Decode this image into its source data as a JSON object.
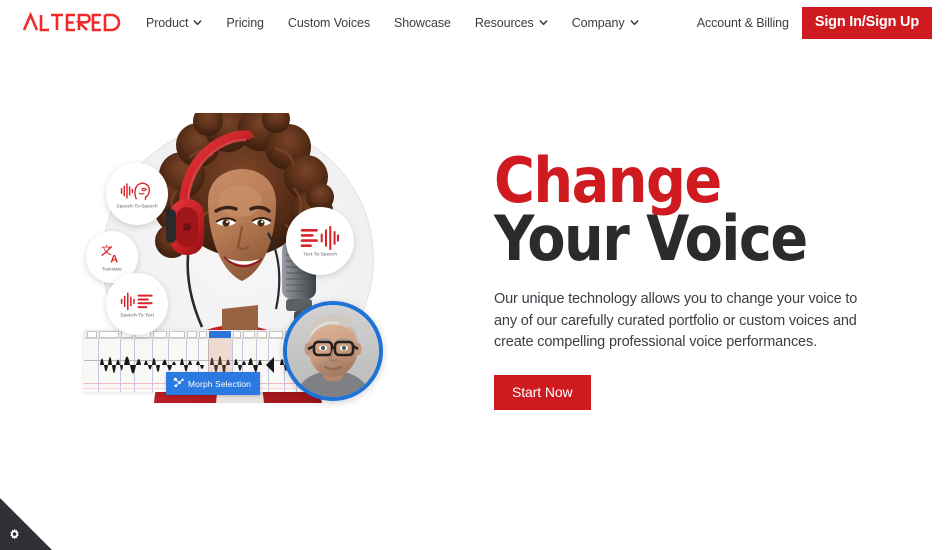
{
  "brand": {
    "name": "ALTERED",
    "logo_color": "#ef2b2b",
    "accent_red": "#cf1a1f",
    "headline_red": "#cf1a1f",
    "headline_dark": "#2b2b2b",
    "blue": "#1c72d6"
  },
  "nav": {
    "items": [
      {
        "label": "Product",
        "has_dropdown": true,
        "icon": "chevron-down-icon"
      },
      {
        "label": "Pricing",
        "has_dropdown": false
      },
      {
        "label": "Custom Voices",
        "has_dropdown": false
      },
      {
        "label": "Showcase",
        "has_dropdown": false
      },
      {
        "label": "Resources",
        "has_dropdown": true,
        "icon": "chevron-down-icon"
      },
      {
        "label": "Company",
        "has_dropdown": true,
        "icon": "chevron-down-icon"
      }
    ],
    "account_link": "Account & Billing",
    "signin_button": "Sign In/Sign Up"
  },
  "hero": {
    "headline_line1": "Change",
    "headline_line2": "Your Voice",
    "paragraph": "Our unique technology allows you to change your voice to any of our carefully curated portfolio or custom voices and create compelling professional voice performances.",
    "cta_button": "Start Now"
  },
  "art": {
    "badges": [
      {
        "label": "Speech-To-Speech",
        "icon": "speech-to-speech-icon"
      },
      {
        "label": "Translate",
        "icon": "translate-icon"
      },
      {
        "label": "Speech-To-Text",
        "icon": "speech-to-text-icon"
      },
      {
        "label": "Text-To-Speech",
        "icon": "text-to-speech-icon"
      }
    ],
    "editor": {
      "morph_button": "Morph Selection",
      "morph_icon": "morph-nodes-icon"
    },
    "woman_alt": "woman-with-red-headphones-photo",
    "man_alt": "man-with-glasses-portrait-photo"
  },
  "cookie_widget": {
    "icon": "gear-icon",
    "label": "Cookie settings"
  }
}
